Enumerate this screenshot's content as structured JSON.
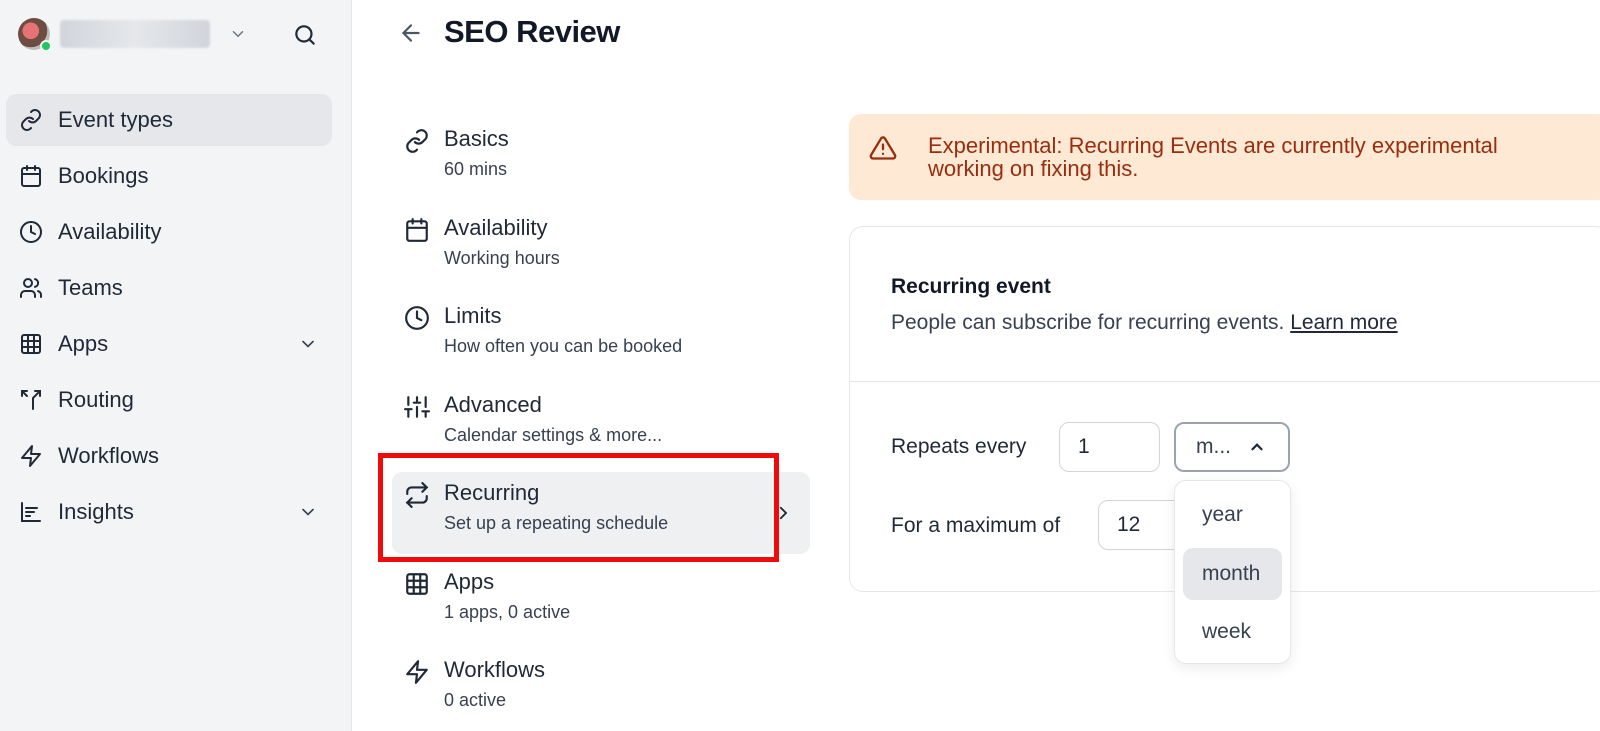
{
  "user": {
    "name_redacted": true
  },
  "sidebar": {
    "items": [
      {
        "label": "Event types",
        "icon": "link-icon",
        "active": true
      },
      {
        "label": "Bookings",
        "icon": "calendar-icon"
      },
      {
        "label": "Availability",
        "icon": "clock-icon"
      },
      {
        "label": "Teams",
        "icon": "users-icon"
      },
      {
        "label": "Apps",
        "icon": "grid-icon",
        "expandable": true
      },
      {
        "label": "Routing",
        "icon": "split-icon"
      },
      {
        "label": "Workflows",
        "icon": "zap-icon"
      },
      {
        "label": "Insights",
        "icon": "bar-chart-icon",
        "expandable": true
      }
    ]
  },
  "header": {
    "title": "SEO Review"
  },
  "menu": {
    "items": [
      {
        "title": "Basics",
        "sub": "60 mins",
        "icon": "link-icon"
      },
      {
        "title": "Availability",
        "sub": "Working hours",
        "icon": "calendar-icon"
      },
      {
        "title": "Limits",
        "sub": "How often you can be booked",
        "icon": "clock-icon"
      },
      {
        "title": "Advanced",
        "sub": "Calendar settings & more...",
        "icon": "sliders-icon"
      },
      {
        "title": "Recurring",
        "sub": "Set up a repeating schedule",
        "icon": "repeat-icon",
        "active": true
      },
      {
        "title": "Apps",
        "sub": "1 apps, 0 active",
        "icon": "grid-icon"
      },
      {
        "title": "Workflows",
        "sub": "0 active",
        "icon": "zap-icon"
      }
    ]
  },
  "banner": {
    "message": "Experimental: Recurring Events are currently experimental",
    "message2": "working on fixing this."
  },
  "recurring": {
    "title": "Recurring event",
    "description": "People can subscribe for recurring events.",
    "learn_more": "Learn more",
    "repeats_label": "Repeats every",
    "repeats_value": "1",
    "unit_display": "m...",
    "max_label": "For a maximum of",
    "max_value": "12",
    "options": [
      "year",
      "month",
      "week"
    ],
    "selected_option": "month"
  },
  "colors": {
    "accent_highlight": "#f00a0a",
    "warning_bg": "#fde9d4",
    "warning_text": "#9a2d0e",
    "online": "#22c55e"
  }
}
